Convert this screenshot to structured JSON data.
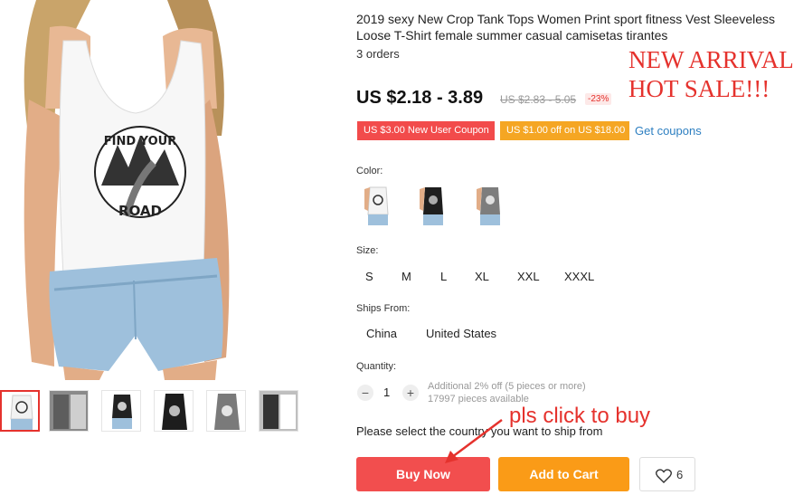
{
  "product": {
    "title": "2019 sexy New Crop Tank Tops Women Print sport fitness Vest Sleeveless Loose T-Shirt female summer casual camisetas tirantes",
    "orders": "3 orders",
    "price": "US $2.18 - 3.89",
    "old_price": "US $2.83 - 5.05",
    "discount": "-23%",
    "shirt_print_line1": "FIND YOUR",
    "shirt_print_line2": "ROAD"
  },
  "coupons": {
    "new_user": "US $3.00 New User Coupon",
    "store": "US $1.00 off on US $18.00",
    "get_link": "Get coupons"
  },
  "promo": {
    "line1": "NEW ARRIVAL",
    "line2": "HOT SALE!!!"
  },
  "options": {
    "color_label": "Color:",
    "colors": [
      "white",
      "black",
      "gray"
    ],
    "size_label": "Size:",
    "sizes": [
      "S",
      "M",
      "L",
      "XL",
      "XXL",
      "XXXL"
    ],
    "ships_label": "Ships From:",
    "ships": [
      "China",
      "United States"
    ]
  },
  "quantity": {
    "label": "Quantity:",
    "minus": "−",
    "plus": "+",
    "value": "1",
    "note1": "Additional 2% off (5 pieces or more)",
    "note2": "17997 pieces available"
  },
  "select_note": "Please select the country you want to ship from",
  "actions": {
    "buy_now": "Buy Now",
    "add_to_cart": "Add to Cart",
    "wishlist_count": "6"
  },
  "annotation": "pls click to buy",
  "colors": {
    "accent_red": "#f24e4e",
    "accent_orange": "#fa9b17",
    "promo_red": "#e5322d",
    "link_blue": "#2d7fc1"
  }
}
